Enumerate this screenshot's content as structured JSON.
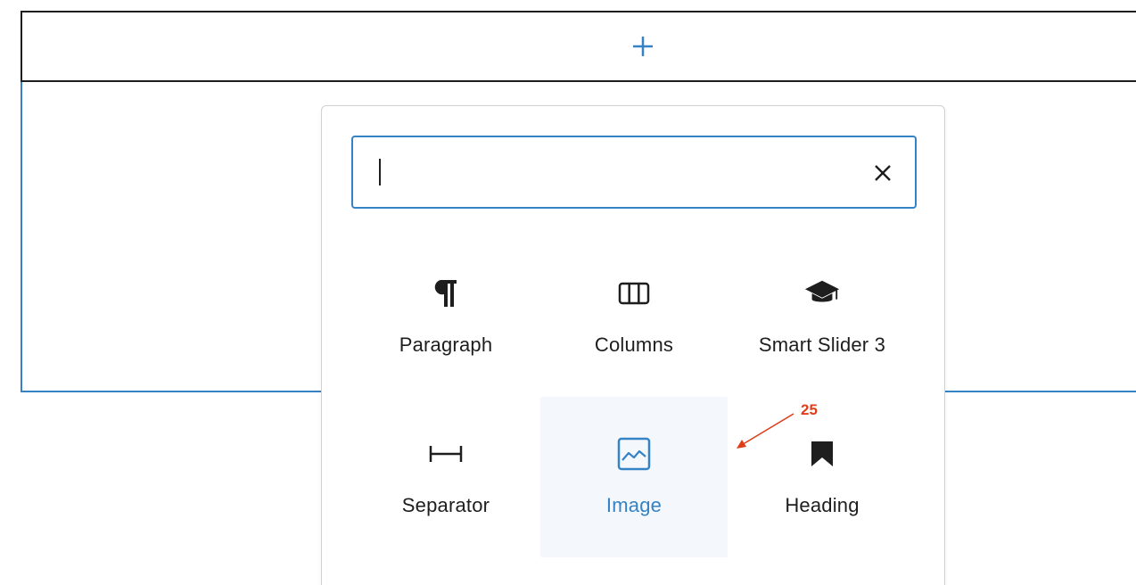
{
  "appender": {
    "add_icon": "plus-icon",
    "accent_color": "#3582c4"
  },
  "inserter": {
    "search": {
      "value": "",
      "placeholder": "",
      "clear_icon": "close-icon"
    },
    "blocks": [
      {
        "label": "Paragraph",
        "icon": "paragraph-icon"
      },
      {
        "label": "Columns",
        "icon": "columns-icon"
      },
      {
        "label": "Smart Slider 3",
        "icon": "graduation-cap-icon"
      },
      {
        "label": "Separator",
        "icon": "separator-icon"
      },
      {
        "label": "Image",
        "icon": "image-icon",
        "active": true
      },
      {
        "label": "Heading",
        "icon": "bookmark-icon"
      }
    ]
  },
  "annotation": {
    "label": "25",
    "color": "#e03e1a"
  },
  "colors": {
    "accent": "#3582c4",
    "text": "#1e1e1e",
    "active_bg": "#f4f8fc"
  }
}
